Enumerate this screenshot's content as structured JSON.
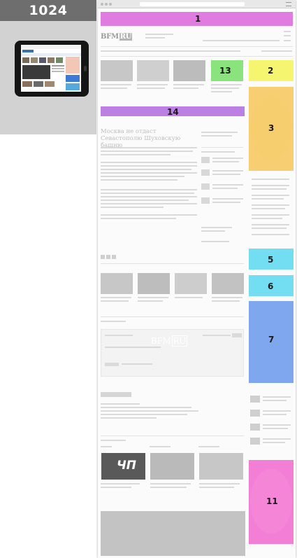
{
  "device": {
    "resolution_label": "1024"
  },
  "page": {
    "logo": "BFM",
    "logo_suffix": "RU",
    "headline": "Москва не отдаст Севастополю Шуховскую башню"
  },
  "zones": [
    {
      "number": "1",
      "color": "#d649d6"
    },
    {
      "number": "2",
      "color": "#f3f33a"
    },
    {
      "number": "3",
      "color": "#f5bd3c"
    },
    {
      "number": "5",
      "color": "#3ed3ee"
    },
    {
      "number": "6",
      "color": "#3ed3ee"
    },
    {
      "number": "7",
      "color": "#4f87ea"
    },
    {
      "number": "11",
      "color": "#ef4fc6"
    },
    {
      "number": "13",
      "color": "#5ed94c"
    },
    {
      "number": "14",
      "color": "#a44fd9"
    }
  ],
  "thumbnails": {
    "cp_label": "ЧП"
  }
}
